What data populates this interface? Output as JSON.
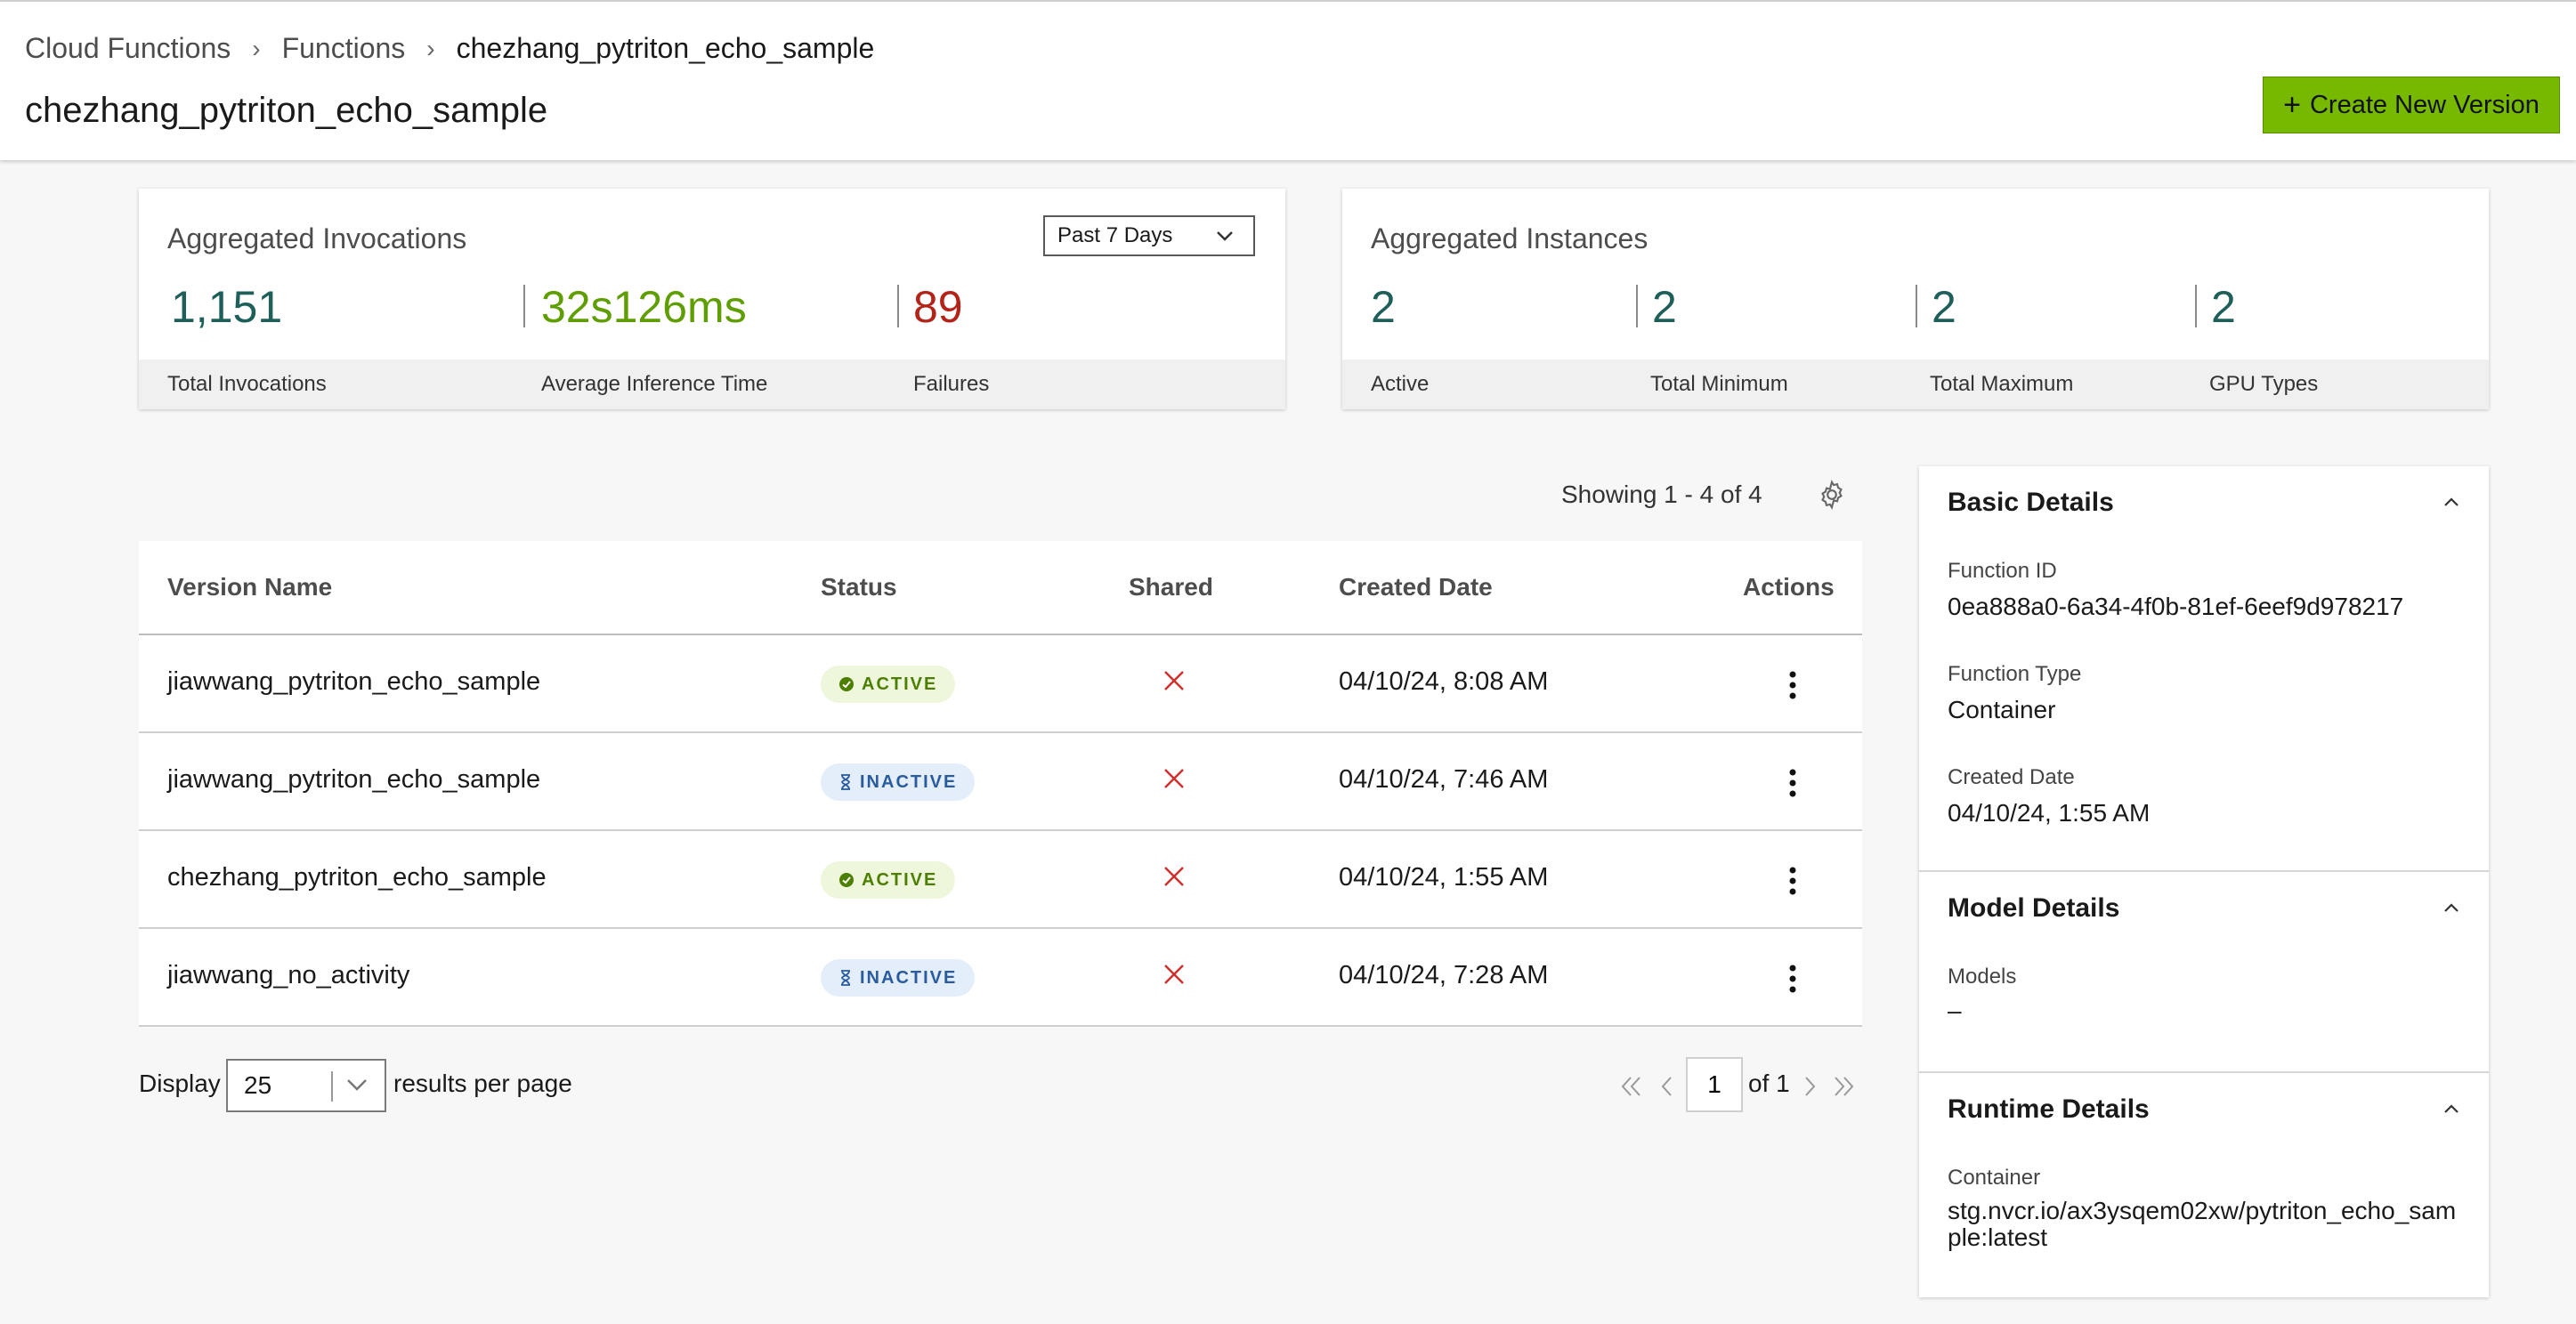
{
  "breadcrumb": [
    "Cloud Functions",
    "Functions",
    "chezhang_pytriton_echo_sample"
  ],
  "page_title": "chezhang_pytriton_echo_sample",
  "create_button": "Create New Version",
  "invocations": {
    "title": "Aggregated Invocations",
    "period": "Past 7 Days",
    "metrics": [
      {
        "value": "1,151",
        "label": "Total Invocations"
      },
      {
        "value": "32s126ms",
        "label": "Average Inference Time"
      },
      {
        "value": "89",
        "label": "Failures"
      }
    ]
  },
  "instances": {
    "title": "Aggregated Instances",
    "metrics": [
      {
        "value": "2",
        "label": "Active"
      },
      {
        "value": "2",
        "label": "Total Minimum"
      },
      {
        "value": "2",
        "label": "Total Maximum"
      },
      {
        "value": "2",
        "label": "GPU Types"
      }
    ]
  },
  "showing": "Showing 1 - 4 of 4",
  "table": {
    "headers": [
      "Version Name",
      "Status",
      "Shared",
      "Created Date",
      "Actions"
    ],
    "rows": [
      {
        "name": "jiawwang_pytriton_echo_sample",
        "status": "ACTIVE",
        "created": "04/10/24, 8:08 AM"
      },
      {
        "name": "jiawwang_pytriton_echo_sample",
        "status": "INACTIVE",
        "created": "04/10/24, 7:46 AM"
      },
      {
        "name": "chezhang_pytriton_echo_sample",
        "status": "ACTIVE",
        "created": "04/10/24, 1:55 AM"
      },
      {
        "name": "jiawwang_no_activity",
        "status": "INACTIVE",
        "created": "04/10/24, 7:28 AM"
      }
    ]
  },
  "pagination": {
    "display_label": "Display",
    "per_page": "25",
    "results_label": "results per page",
    "page": "1",
    "of_label": "of 1"
  },
  "panel": {
    "basic": {
      "title": "Basic Details",
      "function_id_label": "Function ID",
      "function_id": "0ea888a0-6a34-4f0b-81ef-6eef9d978217",
      "function_type_label": "Function Type",
      "function_type": "Container",
      "created_label": "Created Date",
      "created": "04/10/24, 1:55 AM"
    },
    "model": {
      "title": "Model Details",
      "models_label": "Models",
      "models": "–"
    },
    "runtime": {
      "title": "Runtime Details",
      "container_label": "Container",
      "container": "stg.nvcr.io/ax3ysqem02xw/pytriton_echo_sample:latest"
    }
  },
  "colors": {
    "accent": "#76b900",
    "metric_teal": "#1e5f5a",
    "metric_green": "#5f9e00",
    "failure_red": "#b42318"
  }
}
